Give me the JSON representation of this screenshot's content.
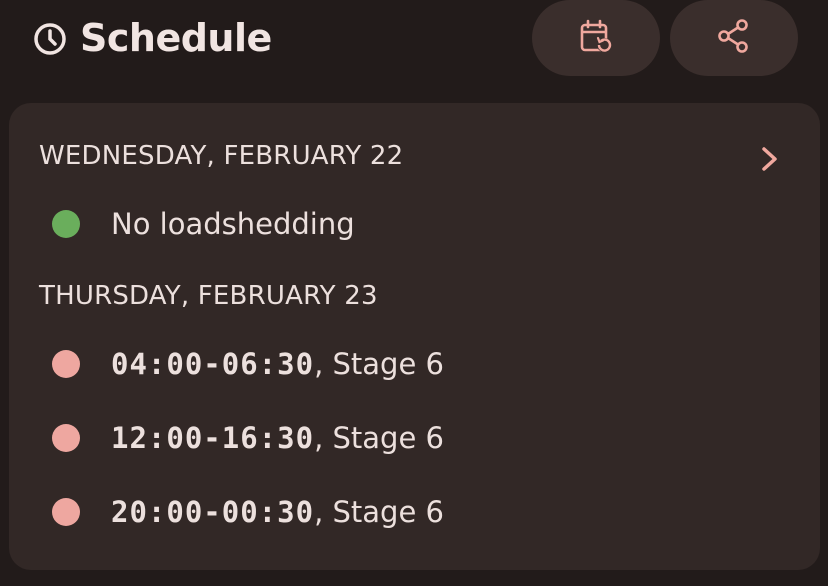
{
  "header": {
    "title": "Schedule",
    "title_icon": "clock-icon",
    "calendar_button_icon": "calendar-refresh-icon",
    "share_button_icon": "share-icon"
  },
  "colors": {
    "background": "#221b1a",
    "card": "#322826",
    "button_bg": "#3a2e2c",
    "accent": "#f0a89e",
    "status_ok": "#6aae5c",
    "status_outage": "#eea7a0"
  },
  "days": [
    {
      "heading": "WEDNESDAY, FEBRUARY 22",
      "entries": [
        {
          "status": "ok",
          "text": "No loadshedding"
        }
      ]
    },
    {
      "heading": "THURSDAY, FEBRUARY 23",
      "entries": [
        {
          "status": "outage",
          "time": "04:00-06:30",
          "stage": ", Stage 6"
        },
        {
          "status": "outage",
          "time": "12:00-16:30",
          "stage": ", Stage 6"
        },
        {
          "status": "outage",
          "time": "20:00-00:30",
          "stage": ", Stage 6"
        }
      ]
    }
  ]
}
